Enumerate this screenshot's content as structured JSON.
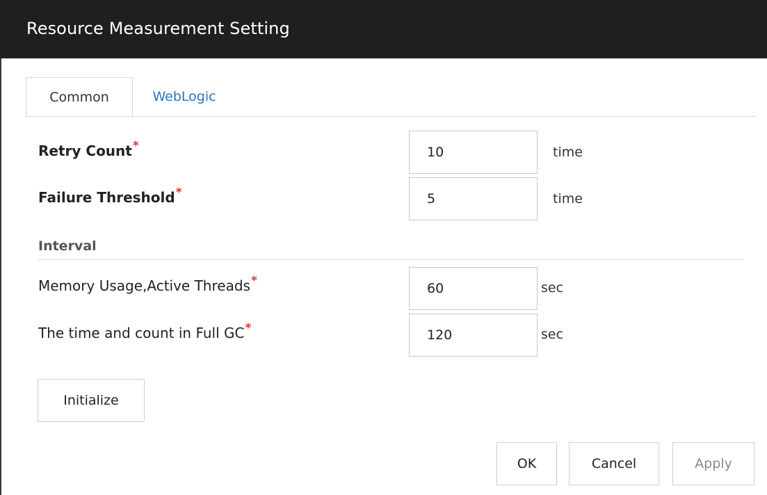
{
  "window": {
    "title": "Resource Measurement Setting"
  },
  "tabs": [
    {
      "label": "Common",
      "active": true
    },
    {
      "label": "WebLogic",
      "active": false
    }
  ],
  "fields": {
    "retry_count": {
      "label": "Retry Count",
      "required_mark": "*",
      "value": "10",
      "unit": "time"
    },
    "failure_threshold": {
      "label": "Failure Threshold",
      "required_mark": "*",
      "value": "5",
      "unit": "time"
    }
  },
  "interval": {
    "heading": "Interval",
    "memory_threads": {
      "label": "Memory Usage,Active Threads",
      "required_mark": "*",
      "value": "60",
      "unit": "sec"
    },
    "full_gc": {
      "label": "The time and count in Full GC",
      "required_mark": "*",
      "value": "120",
      "unit": "sec"
    }
  },
  "buttons": {
    "initialize": "Initialize",
    "ok": "OK",
    "cancel": "Cancel",
    "apply": "Apply"
  },
  "colors": {
    "titlebar": "#1f1f1f",
    "link_tab": "#2f74c0",
    "required": "#e0332e"
  }
}
